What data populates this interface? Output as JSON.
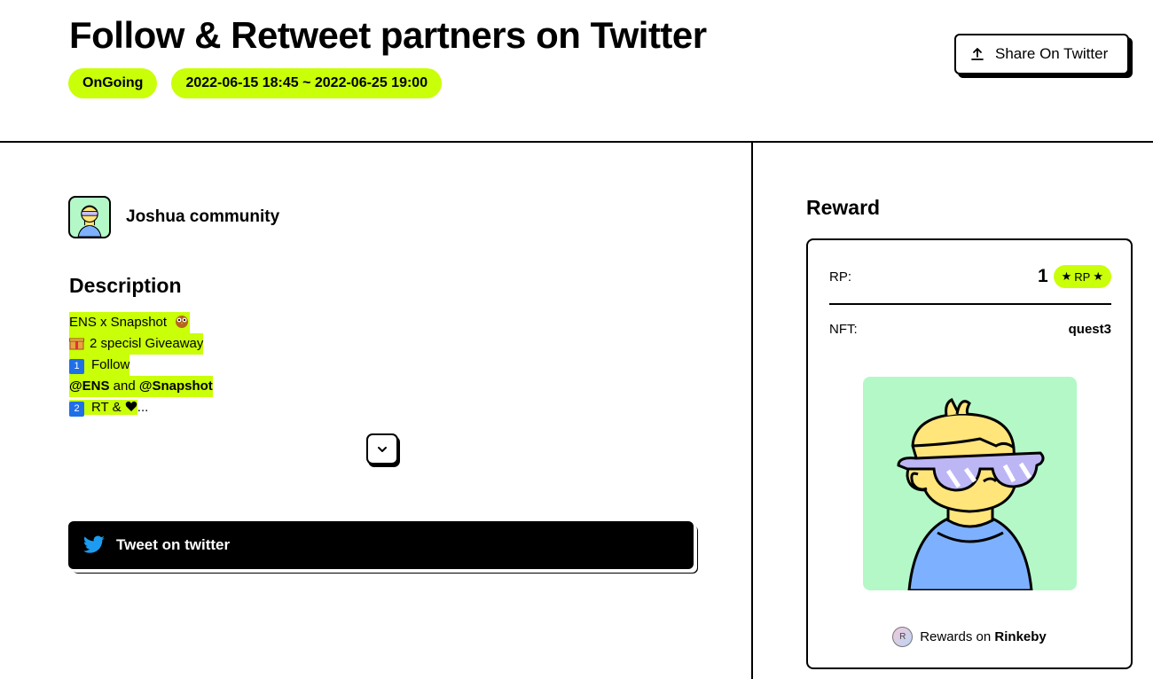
{
  "header": {
    "title": "Follow & Retweet partners on Twitter",
    "status": "OnGoing",
    "date_range": "2022-06-15 18:45 ~ 2022-06-25 19:00",
    "share_label": "Share On Twitter"
  },
  "org": {
    "name": "Joshua community"
  },
  "description": {
    "title": "Description",
    "line1": "ENS x Snapshot",
    "line2": "2 specisl Giveaway",
    "line3_num": "1",
    "line3": "Follow",
    "line4_a": "@ENS",
    "line4_b": " and ",
    "line4_c": "@Snapshot",
    "line5_num": "2",
    "line5": "RT & ",
    "line5_tail": "..."
  },
  "tweet_button": {
    "label": "Tweet on twitter"
  },
  "reward": {
    "title": "Reward",
    "rp_label": "RP:",
    "rp_value": "1",
    "rp_badge": "RP",
    "nft_label": "NFT:",
    "nft_value": "quest3",
    "rewards_on_prefix": "Rewards on ",
    "chain": "Rinkeby",
    "chain_icon_letter": "R"
  },
  "colors": {
    "accent": "#c9ff08",
    "nft_bg": "#b4f8c8",
    "twitter_blue": "#1d9bf0"
  },
  "icons": [
    "upload-icon",
    "chevron-down-icon",
    "twitter-bird-icon",
    "owl-emoji-icon",
    "gift-emoji-icon",
    "heart-icon",
    "rinkeby-icon"
  ]
}
